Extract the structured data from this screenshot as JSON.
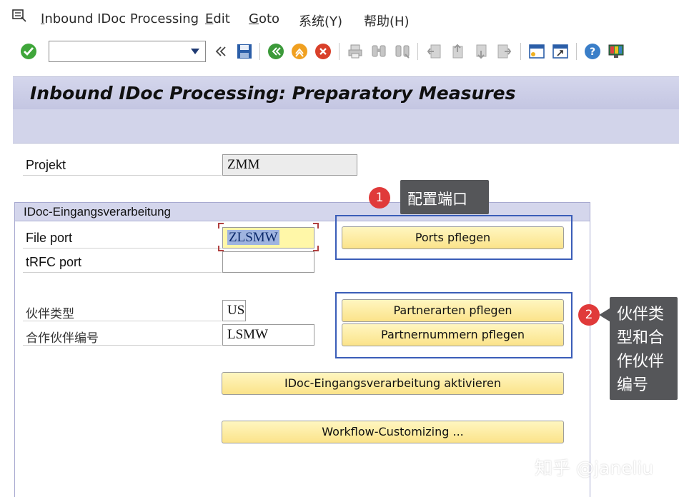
{
  "menu": {
    "items": [
      "Inbound IDoc Processing",
      "Edit",
      "Goto",
      "系统(Y)",
      "帮助(H)"
    ]
  },
  "toolbar": {
    "command_field": "",
    "icons": [
      "enter-icon",
      "back-icon",
      "save-icon",
      "back-green-icon",
      "exit-icon",
      "cancel-icon",
      "print-icon",
      "find-icon",
      "find-next-icon",
      "first-page-icon",
      "prev-page-icon",
      "next-page-icon",
      "last-page-icon",
      "new-session-icon",
      "shortcut-icon",
      "help-icon",
      "customize-layout-icon"
    ]
  },
  "title": "Inbound IDoc Processing: Preparatory Measures",
  "project": {
    "label": "Projekt",
    "value": "ZMM"
  },
  "group": {
    "title": "IDoc-Eingangsverarbeitung",
    "file_port_label": "File port",
    "file_port_value": "ZLSMW",
    "trfc_port_label": "tRFC port",
    "trfc_port_value": "",
    "partner_type_label": "伙伴类型",
    "partner_type_value": "US",
    "partner_number_label": "合作伙伴编号",
    "partner_number_value": "LSMW"
  },
  "buttons": {
    "ports": "Ports pflegen",
    "partner_types": "Partnerarten pflegen",
    "partner_numbers": "Partnernummern pflegen",
    "activate": "IDoc-Eingangsverarbeitung aktivieren",
    "workflow": "Workflow-Customizing ..."
  },
  "annotations": {
    "callout1_num": "1",
    "callout1_text": "配置端口",
    "callout2_num": "2",
    "callout2_lines": [
      "伙伴类",
      "型和合",
      "作伙伴",
      "编号"
    ]
  },
  "watermark": "知乎 @janeliu",
  "colors": {
    "title_bar": "#d4d6ec",
    "button": "#fbe38a",
    "highlight_box": "#3a5db8",
    "callout_bg": "#555659",
    "callout_number": "#e03a3a"
  }
}
